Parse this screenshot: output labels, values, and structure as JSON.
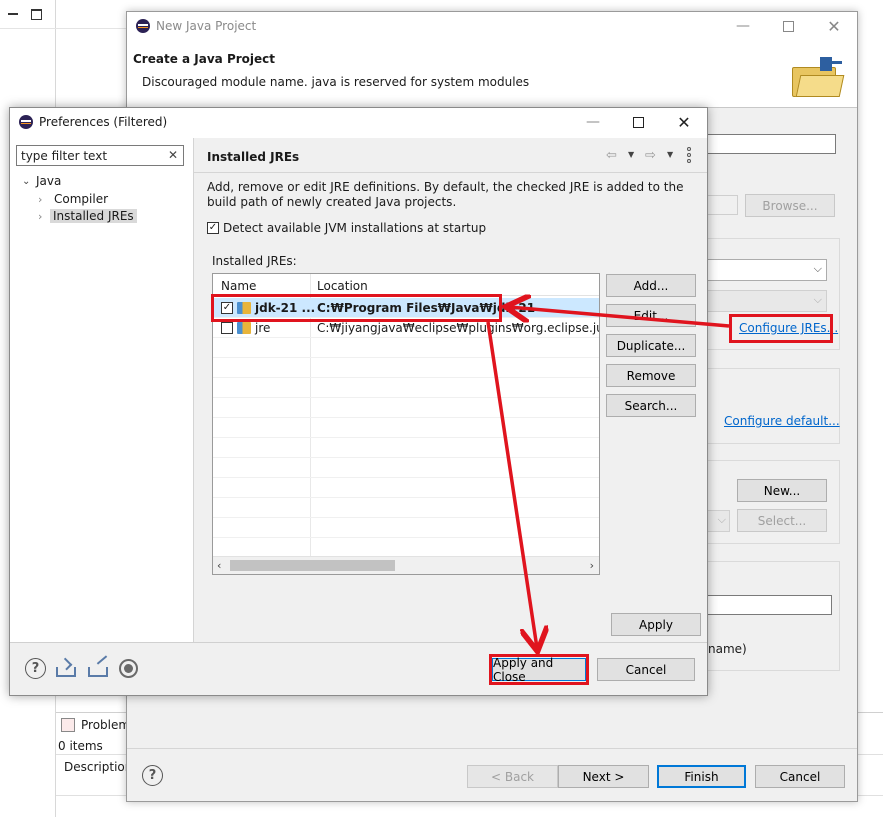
{
  "background": {
    "problems_tab": "Problem",
    "items_count": "0 items",
    "description_header": "Description"
  },
  "new_project": {
    "title": "New Java Project",
    "header_title": "Create a Java Project",
    "header_message": "Discouraged module name. java is reserved for system modules",
    "browse": "Browse...",
    "configure_jres": "Configure JREs...",
    "configure_default": "Configure default...",
    "new_btn": "New...",
    "select_btn": "Select...",
    "module_name_suffix": "name)",
    "help": "?",
    "back": "< Back",
    "next": "Next >",
    "finish": "Finish",
    "cancel": "Cancel"
  },
  "preferences": {
    "title": "Preferences (Filtered)",
    "filter_value": "type filter text",
    "tree": {
      "root": "Java",
      "children": [
        "Compiler",
        "Installed JREs"
      ]
    },
    "page_title": "Installed JREs",
    "description": "Add, remove or edit JRE definitions. By default, the checked JRE is added to the build path of newly created Java projects.",
    "detect_label": "Detect available JVM installations at startup",
    "installed_label": "Installed JREs:",
    "columns": [
      "Name",
      "Location"
    ],
    "rows": [
      {
        "name": "jdk-21 ...",
        "location": "C:₩Program Files₩Java₩jdk-21",
        "checked": true
      },
      {
        "name": "jre",
        "location": "C:₩jiyangjava₩eclipse₩plugins₩org.eclipse.justj.open",
        "checked": false
      }
    ],
    "buttons": {
      "add": "Add...",
      "edit": "Edit...",
      "duplicate": "Duplicate...",
      "remove": "Remove",
      "search": "Search..."
    },
    "apply": "Apply",
    "apply_close": "Apply and Close",
    "cancel": "Cancel"
  },
  "colors": {
    "annotation_red": "#e0141e",
    "link_blue": "#0066cc",
    "selection_blue": "#cce8ff"
  }
}
